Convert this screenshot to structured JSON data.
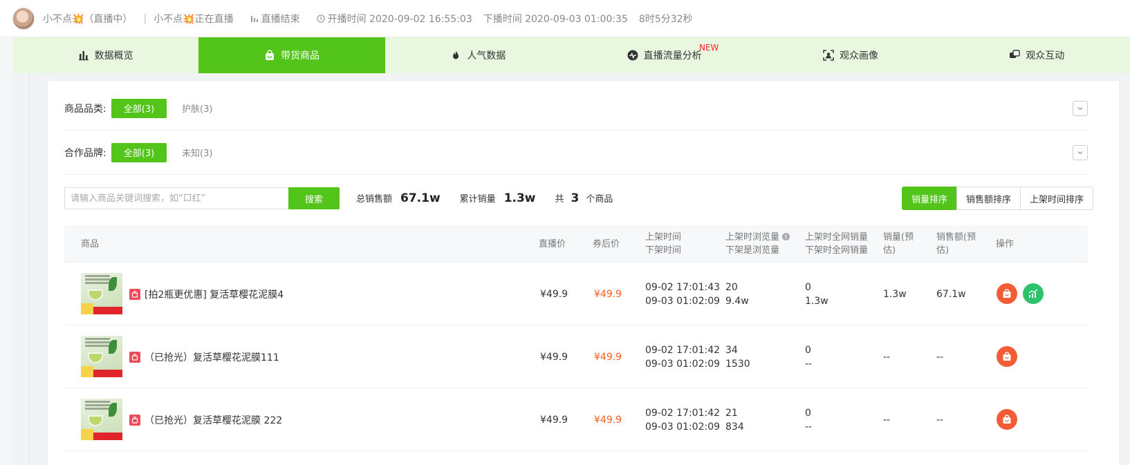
{
  "header": {
    "anchor_name": "小不点💥（直播中）",
    "room_label": "小不点💥正在直播",
    "live_status": "直播结束",
    "start_time": "开播时间 2020-09-02 16:55:03",
    "end_time": "下播时间 2020-09-03 01:00:35",
    "duration": "8时5分32秒"
  },
  "tabs": [
    {
      "label": "数据概览",
      "icon": "bar-chart-icon"
    },
    {
      "label": "带货商品",
      "icon": "shopping-bag-icon",
      "active": true
    },
    {
      "label": "人气数据",
      "icon": "fire-icon"
    },
    {
      "label": "直播流量分析",
      "icon": "pulse-icon",
      "badge": "NEW"
    },
    {
      "label": "观众画像",
      "icon": "portrait-icon"
    },
    {
      "label": "观众互动",
      "icon": "chat-icon"
    }
  ],
  "filters": {
    "category_label": "商品品类:",
    "category_all": "全部(3)",
    "category_opt": "护肤(3)",
    "brand_label": "合作品牌:",
    "brand_all": "全部(3)",
    "brand_opt": "未知(3)"
  },
  "search": {
    "placeholder": "请输入商品关键词搜索，如“口红”",
    "button": "搜索"
  },
  "stats": {
    "gmv_label": "总销售额",
    "gmv_value": "67.1w",
    "sales_label": "累计销量",
    "sales_value": "1.3w",
    "count_prefix": "共",
    "count_value": "3",
    "count_suffix": "个商品"
  },
  "sort": [
    "销量排序",
    "销售额排序",
    "上架时间排序"
  ],
  "columns": {
    "product": "商品",
    "live_price": "直播价",
    "coupon_price": "券后价",
    "on_time": "上架时间",
    "off_time": "下架时间",
    "on_views": "上架时浏览量",
    "off_views": "下架是浏览量",
    "on_sales": "上架时全网销量",
    "off_sales": "下架时全网销量",
    "est_sales_1": "销量(预",
    "est_sales_2": "估)",
    "est_gmv_1": "销售额(预",
    "est_gmv_2": "估)",
    "action": "操作"
  },
  "rows": [
    {
      "name": "[拍2瓶更优惠] 复活草樱花泥膜4",
      "live_price": "¥49.9",
      "coupon_price": "¥49.9",
      "on_time": "09-02 17:01:43",
      "off_time": "09-03 01:02:09",
      "on_views": "20",
      "off_views": "9.4w",
      "on_sales": "0",
      "off_sales": "1.3w",
      "est_sales": "1.3w",
      "est_gmv": "67.1w"
    },
    {
      "name": "（已抢光）复活草樱花泥膜111",
      "live_price": "¥49.9",
      "coupon_price": "¥49.9",
      "on_time": "09-02 17:01:42",
      "off_time": "09-03 01:02:09",
      "on_views": "34",
      "off_views": "1530",
      "on_sales": "0",
      "off_sales": "--",
      "est_sales": "--",
      "est_gmv": "--"
    },
    {
      "name": "（已抢光）复活草樱花泥膜 222",
      "live_price": "¥49.9",
      "coupon_price": "¥49.9",
      "on_time": "09-02 17:01:42",
      "off_time": "09-03 01:02:09",
      "on_views": "21",
      "off_views": "834",
      "on_sales": "0",
      "off_sales": "--",
      "est_sales": "--",
      "est_gmv": "--"
    }
  ],
  "colors": {
    "accent": "#52c41a",
    "price": "#ff5a1f",
    "action_orange": "#f45c36",
    "action_green": "#2cc36b"
  }
}
